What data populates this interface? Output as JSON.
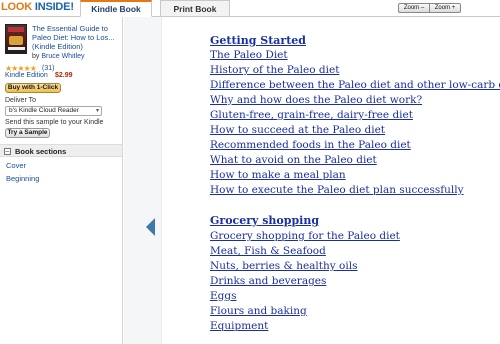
{
  "topbar": {
    "logo_look": "LOOK",
    "logo_inside": " INSIDE!",
    "tabs": [
      "Kindle Book",
      "Print Book"
    ],
    "zoom_out": "Zoom –",
    "zoom_in": "Zoom +"
  },
  "book": {
    "title": "The Essential Guide to Paleo Diet: How to Los... (Kindle Edition)",
    "by": "by ",
    "author": "Bruce Whitley",
    "stars": "★★★★★",
    "rating_count": "(31)",
    "edition": "Kindle Edition",
    "price": "$2.99",
    "buy_button": "Buy with 1-Click",
    "deliver_to": "Deliver To",
    "device_select": "b's Kindle Cloud Reader",
    "send_sample_text": "Send this sample to your Kindle",
    "sample_button": "Try a Sample"
  },
  "sections": {
    "heading": "Book sections",
    "items": [
      "Cover",
      "Beginning"
    ]
  },
  "collapse_icon": "«",
  "toc": {
    "items": [
      {
        "text": "Getting Started",
        "heading": true
      },
      {
        "text": "The Paleo Diet"
      },
      {
        "text": "History of the Paleo diet"
      },
      {
        "text": "Difference between the Paleo diet and other low-carb diets"
      },
      {
        "text": "Why and how does the Paleo diet work?"
      },
      {
        "text": "Gluten-free, grain-free, dairy-free diet"
      },
      {
        "text": "How to succeed at the Paleo diet"
      },
      {
        "text": "Recommended foods in the Paleo diet"
      },
      {
        "text": "What to avoid on the Paleo diet"
      },
      {
        "text": "How to make a meal plan"
      },
      {
        "text": "How to execute the Paleo diet plan successfully"
      },
      {
        "text": "Grocery shopping",
        "heading": true
      },
      {
        "text": "Grocery shopping for the Paleo diet"
      },
      {
        "text": "Meat, Fish & Seafood"
      },
      {
        "text": "Nuts, berries & healthy oils"
      },
      {
        "text": "Drinks and beverages"
      },
      {
        "text": "Eggs"
      },
      {
        "text": "Flours and baking"
      },
      {
        "text": "Equipment"
      }
    ]
  }
}
